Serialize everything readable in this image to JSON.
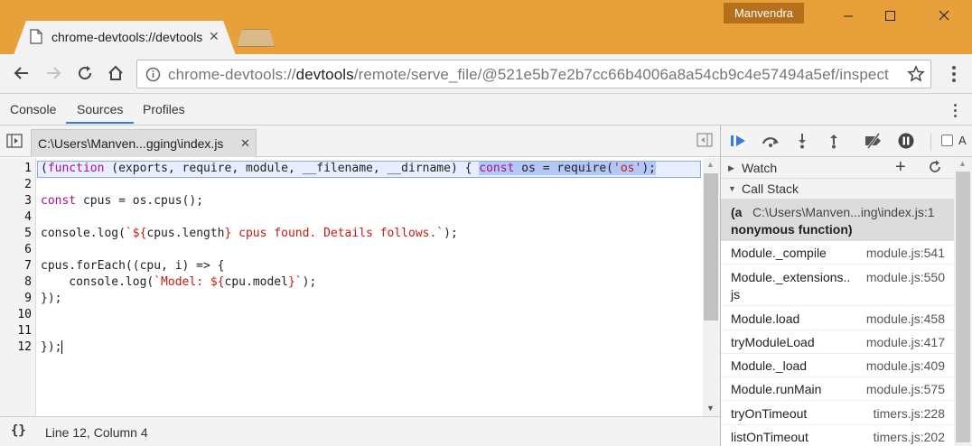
{
  "browser": {
    "profile_name": "Manvendra",
    "tab_title": "chrome-devtools://devtools",
    "url_scheme": "chrome-devtools://",
    "url_host": "devtools",
    "url_path": "/remote/serve_file/@521e5b7e2b7cc66b4006a8a54cb9c4e57494a5ef/inspect"
  },
  "devtools": {
    "tabs": [
      {
        "label": "Console"
      },
      {
        "label": "Sources"
      },
      {
        "label": "Profiles"
      }
    ],
    "active_tab": "Sources"
  },
  "editor": {
    "open_file": "C:\\Users\\Manven...gging\\index.js",
    "line_numbers": [
      "1",
      "2",
      "3",
      "4",
      "5",
      "6",
      "7",
      "8",
      "9",
      "10",
      "11",
      "12"
    ],
    "code": {
      "l1_open": "(",
      "l1_kw_function": "function",
      "l1_params": " (exports, require, module, __filename, __dirname) { ",
      "l1_kw_const": "const",
      "l1_mid": " os = require(",
      "l1_str": "'os'",
      "l1_end": ");",
      "l3_kw": "const",
      "l3_rest": " cpus = os.cpus();",
      "l5_pre": "console.log(",
      "l5_str1": "`${",
      "l5_mid": "cpus.length",
      "l5_str2": "} cpus found. Details follows.`",
      "l5_end": ");",
      "l7": "cpus.forEach((cpu, i) => {",
      "l8_pre": "    console.log(",
      "l8_str1": "`Model: ${",
      "l8_mid": "cpu.model",
      "l8_str2": "}`",
      "l8_end": ");",
      "l9": "});",
      "l12": "});"
    },
    "status": {
      "pretty_print": "{}",
      "cursor_position": "Line 12, Column 4"
    }
  },
  "debugger": {
    "pause_on_caught_label": "A",
    "watch_label": "Watch",
    "call_stack_label": "Call Stack",
    "selected_frame": {
      "name_start": "(a",
      "location": "C:\\Users\\Manven...ing\\index.js:1",
      "name_rest": "nonymous function)"
    },
    "frames": [
      {
        "name": "Module._compile",
        "location": "module.js:541"
      },
      {
        "name": "Module._extensions..",
        "name_wrap": "js",
        "location": "module.js:550"
      },
      {
        "name": "Module.load",
        "location": "module.js:458"
      },
      {
        "name": "tryModuleLoad",
        "location": "module.js:417"
      },
      {
        "name": "Module._load",
        "location": "module.js:409"
      },
      {
        "name": "Module.runMain",
        "location": "module.js:575"
      },
      {
        "name": "tryOnTimeout",
        "location": "timers.js:228"
      },
      {
        "name": "listOnTimeout",
        "location": "timers.js:202"
      }
    ]
  },
  "colors": {
    "titlebar": "#e8a13a",
    "keyword": "#aa0d91",
    "string": "#c41a16",
    "selection": "#b3c8f6",
    "active_tab_underline": "#3879d9"
  }
}
